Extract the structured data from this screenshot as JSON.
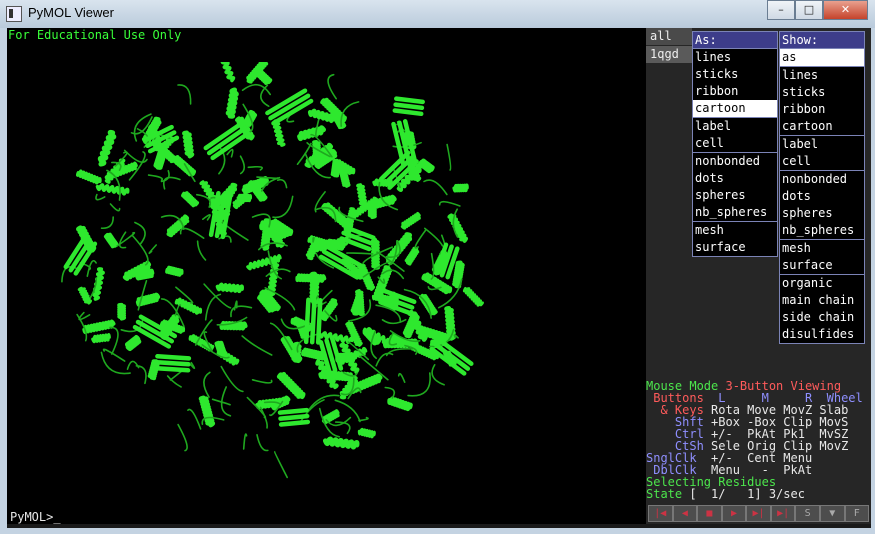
{
  "window": {
    "title": "PyMOL Viewer",
    "minimize": "–",
    "maximize": "□",
    "close": "✕"
  },
  "viewer": {
    "banner": "For Educational Use Only",
    "prompt": "PyMOL>_",
    "molecule_color": "#2ee82e"
  },
  "objects": [
    "all",
    "1qgd"
  ],
  "as_menu": {
    "header": "As:",
    "groups": [
      [
        "lines",
        "sticks",
        "ribbon",
        "cartoon"
      ],
      [
        "label",
        "cell"
      ],
      [
        "nonbonded",
        "dots",
        "spheres",
        "nb_spheres"
      ],
      [
        "mesh",
        "surface"
      ]
    ],
    "selected": "cartoon"
  },
  "show_menu": {
    "header": "Show:",
    "groups": [
      [
        "as"
      ],
      [
        "lines",
        "sticks",
        "ribbon",
        "cartoon"
      ],
      [
        "label",
        "cell"
      ],
      [
        "nonbonded",
        "dots",
        "spheres",
        "nb_spheres"
      ],
      [
        "mesh",
        "surface"
      ],
      [
        "organic",
        "main chain",
        "side chain",
        "disulfides"
      ]
    ],
    "selected": "as"
  },
  "mouse_info": {
    "mode_label": "Mouse Mode",
    "mode_value": "3-Button Viewing",
    "rows": [
      [
        {
          "t": " Buttons ",
          "c": "r"
        },
        {
          "t": " L     M     R  ",
          "c": "b"
        },
        {
          "t": "Wheel",
          "c": "b"
        }
      ],
      [
        {
          "t": "  & Keys ",
          "c": "r"
        },
        {
          "t": "Rota Move MovZ Slab",
          "c": "w"
        }
      ],
      [
        {
          "t": "    Shft ",
          "c": "b"
        },
        {
          "t": "+Box -Box Clip MovS",
          "c": "w"
        }
      ],
      [
        {
          "t": "    Ctrl ",
          "c": "b"
        },
        {
          "t": "+/-  PkAt Pk1  MvSZ",
          "c": "w"
        }
      ],
      [
        {
          "t": "    CtSh ",
          "c": "b"
        },
        {
          "t": "Sele Orig Clip MovZ",
          "c": "w"
        }
      ],
      [
        {
          "t": "SnglClk  ",
          "c": "b"
        },
        {
          "t": "+/-  Cent Menu",
          "c": "w"
        }
      ],
      [
        {
          "t": " DblClk  ",
          "c": "b"
        },
        {
          "t": "Menu   -  PkAt",
          "c": "w"
        }
      ]
    ],
    "selecting": "Selecting Residues",
    "state_label": "State",
    "state_value": "[  1/   1] 3/sec"
  },
  "controls": [
    "|◀",
    "◀",
    "■",
    "▶",
    "▶|",
    "▶|",
    "S",
    "▼",
    "F"
  ]
}
